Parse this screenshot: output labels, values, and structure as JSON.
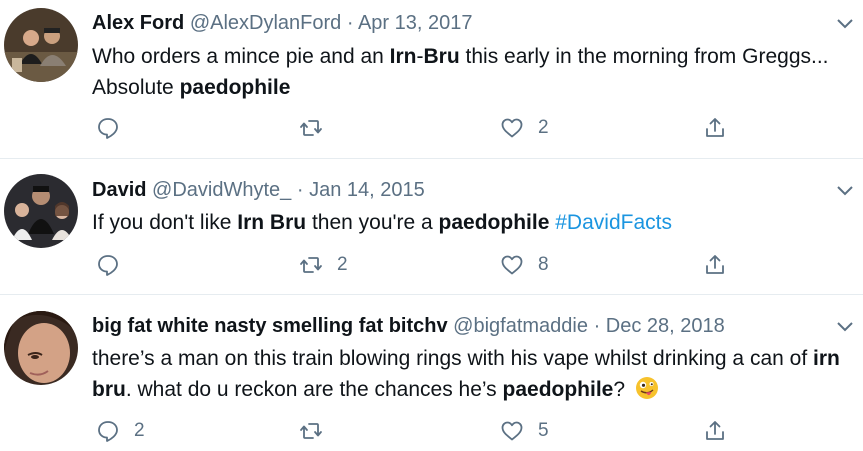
{
  "tweets": [
    {
      "name": "Alex Ford",
      "handle": "@AlexDylanFord",
      "sep": "·",
      "date": "Apr 13, 2017",
      "text": [
        {
          "t": "Who orders a mince pie and an ",
          "s": "plain"
        },
        {
          "t": "Irn",
          "s": "bold"
        },
        {
          "t": "-",
          "s": "plain"
        },
        {
          "t": "Bru",
          "s": "bold"
        },
        {
          "t": " this early in the morning from Greggs... Absolute ",
          "s": "plain"
        },
        {
          "t": "paedophile",
          "s": "bold"
        }
      ],
      "reply_count": "",
      "retweet_count": "",
      "like_count": "2"
    },
    {
      "name": "David",
      "handle": "@DavidWhyte_",
      "sep": "·",
      "date": "Jan 14, 2015",
      "text": [
        {
          "t": "If you don't like ",
          "s": "plain"
        },
        {
          "t": "Irn Bru",
          "s": "bold"
        },
        {
          "t": " then you're a ",
          "s": "plain"
        },
        {
          "t": "paedophile",
          "s": "bold"
        },
        {
          "t": " ",
          "s": "plain"
        },
        {
          "t": "#DavidFacts",
          "s": "hashtag"
        }
      ],
      "reply_count": "",
      "retweet_count": "2",
      "like_count": "8"
    },
    {
      "name": "big fat white nasty smelling fat bitchv",
      "handle": "@bigfatmaddie",
      "sep": "·",
      "date": "Dec 28, 2018",
      "text": [
        {
          "t": "there’s a man on this train blowing rings with his vape whilst drinking a can of ",
          "s": "plain"
        },
        {
          "t": "irn bru",
          "s": "bold"
        },
        {
          "t": ". what do u reckon are the chances he’s ",
          "s": "plain"
        },
        {
          "t": "paedophile",
          "s": "bold"
        },
        {
          "t": "? ",
          "s": "plain"
        }
      ],
      "emoji": "zany-face-emoji",
      "reply_count": "2",
      "retweet_count": "",
      "like_count": "5"
    }
  ],
  "icons": {
    "reply": "reply-icon",
    "retweet": "retweet-icon",
    "like": "heart-icon",
    "share": "share-icon",
    "more": "chevron-down-icon"
  },
  "colors": {
    "text": "#0f1419",
    "muted": "#5b7083",
    "link": "#1b95e0",
    "divider": "#e6ecf0"
  }
}
